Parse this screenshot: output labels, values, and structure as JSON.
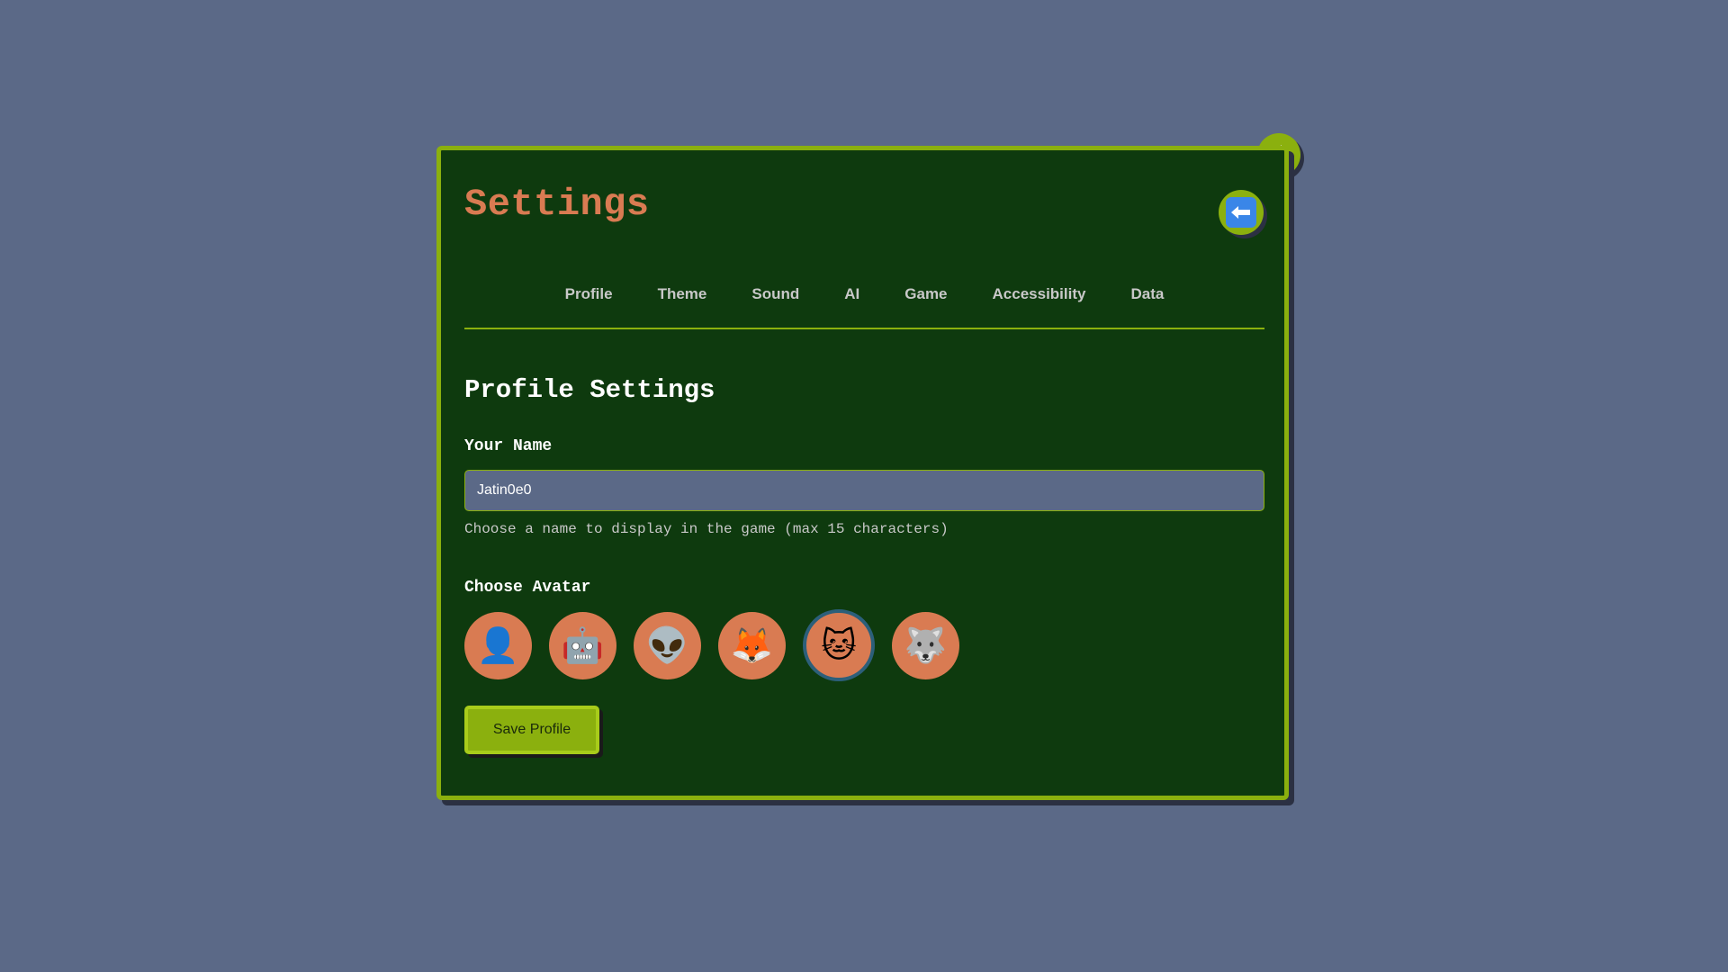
{
  "header": {
    "title": "Settings",
    "sound_icon": "speaker-icon",
    "back_icon": "left-arrow-icon"
  },
  "tabs": [
    {
      "label": "Profile"
    },
    {
      "label": "Theme"
    },
    {
      "label": "Sound"
    },
    {
      "label": "AI"
    },
    {
      "label": "Game"
    },
    {
      "label": "Accessibility"
    },
    {
      "label": "Data"
    }
  ],
  "profile": {
    "section_title": "Profile Settings",
    "name_label": "Your Name",
    "name_value": "Jatin0e0",
    "name_hint": "Choose a name to display in the game (max 15 characters)",
    "avatar_label": "Choose Avatar",
    "avatars": [
      {
        "emoji": "👤",
        "name": "person"
      },
      {
        "emoji": "🤖",
        "name": "robot"
      },
      {
        "emoji": "👽",
        "name": "alien"
      },
      {
        "emoji": "🦊",
        "name": "fox"
      },
      {
        "emoji": "🐱",
        "name": "cat",
        "selected": true
      },
      {
        "emoji": "🐺",
        "name": "wolf"
      }
    ],
    "save_label": "Save Profile"
  },
  "colors": {
    "background": "#5b6987",
    "panel": "#0e3a0e",
    "accent": "#8bb00e",
    "title": "#d97b52",
    "avatar_bg": "#d97b52",
    "selected_ring": "#2c5f7a"
  }
}
